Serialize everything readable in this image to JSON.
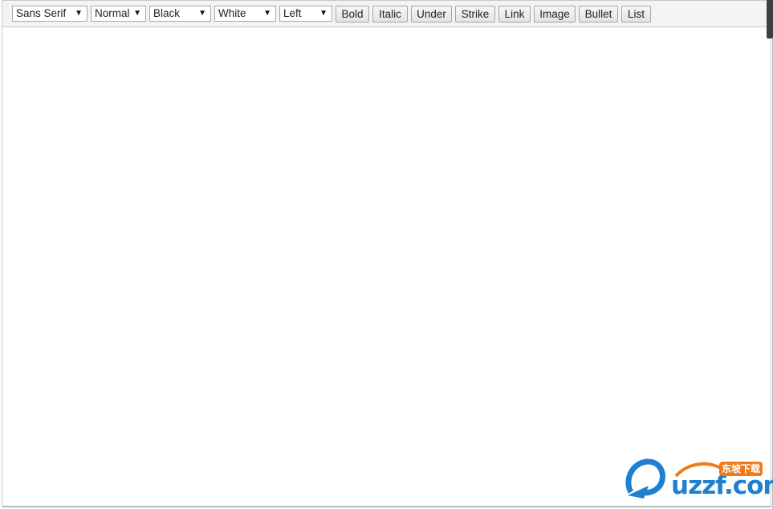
{
  "toolbar": {
    "font_family": {
      "value": "Sans Serif",
      "icon": "chevron-down-icon"
    },
    "font_size": {
      "value": "Normal",
      "icon": "chevron-down-icon"
    },
    "text_color": {
      "value": "Black",
      "icon": "chevron-down-icon"
    },
    "background_color": {
      "value": "White",
      "icon": "chevron-down-icon"
    },
    "alignment": {
      "value": "Left",
      "icon": "chevron-down-icon"
    },
    "arrow_glyph": "▼",
    "buttons": [
      "Bold",
      "Italic",
      "Under",
      "Strike",
      "Link",
      "Image",
      "Bullet",
      "List"
    ]
  },
  "editor": {
    "content": ""
  },
  "watermark": {
    "brand": "uzzf.com",
    "brand_cn": "东坡下载",
    "colors": {
      "blue": "#1f7fd0",
      "orange": "#f07a1a"
    }
  }
}
